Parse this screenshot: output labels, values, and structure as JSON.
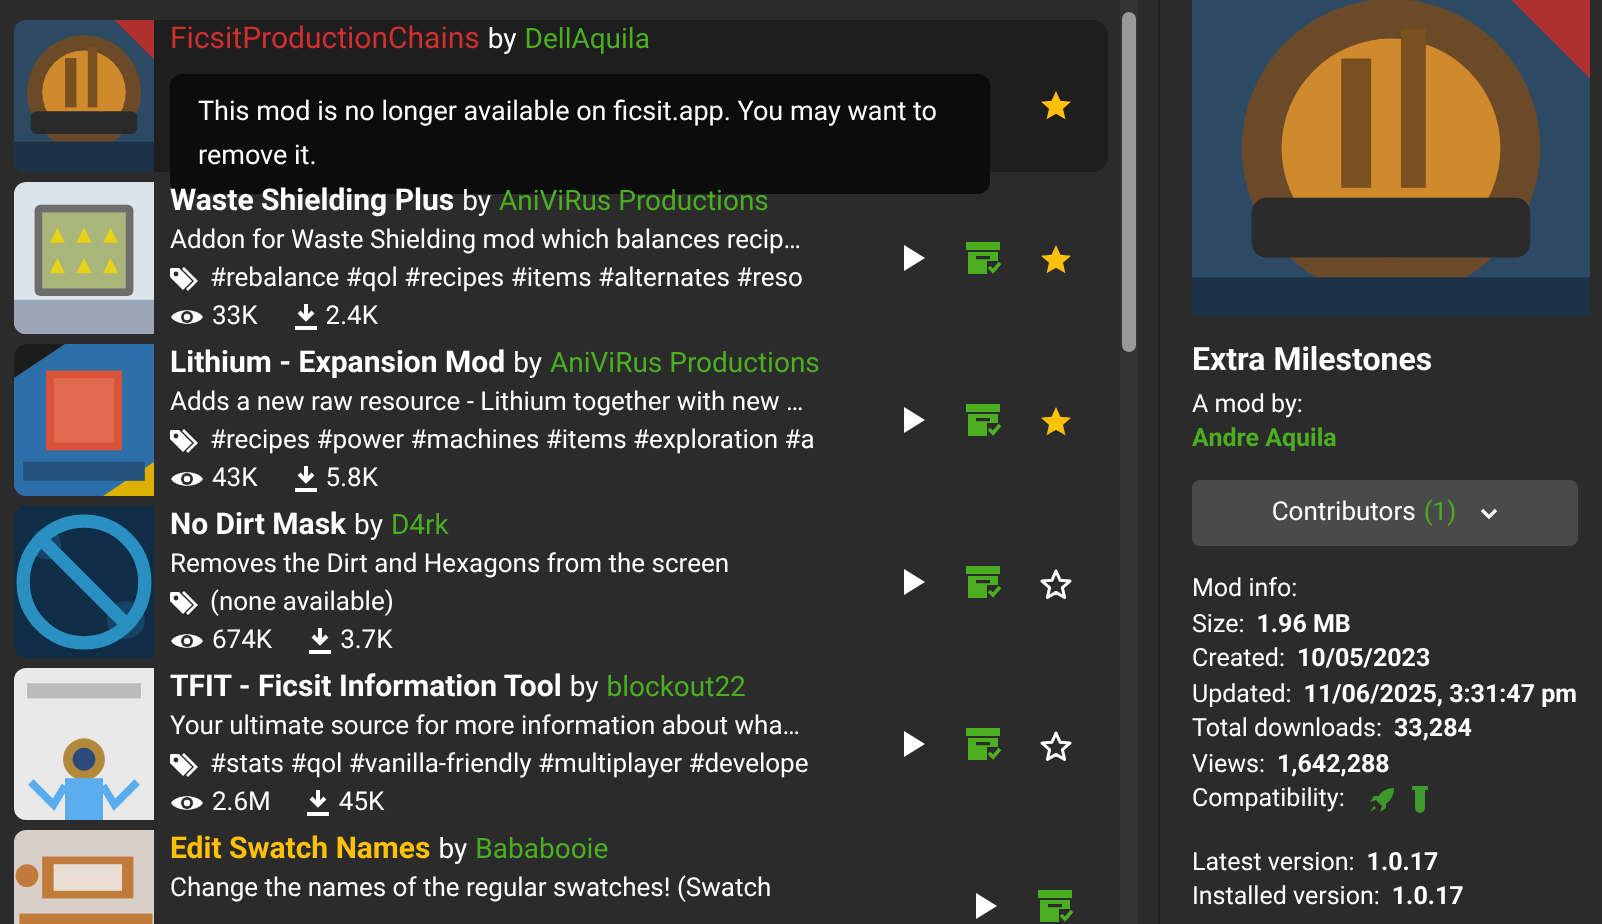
{
  "mods": [
    {
      "kind": "unavailable",
      "title": "FicsitProductionChains",
      "color": "#d32f2f",
      "by": "by",
      "author": "DellAquila",
      "notice": "This mod is no longer available on ficsit.app. You may want to remove it.",
      "favorite": true
    },
    {
      "kind": "installed",
      "title": "Waste Shielding Plus",
      "color": "#ffffff",
      "by": "by",
      "author": "AniViRus Productions",
      "description": "Addon for Waste Shielding mod which balances recip…",
      "tags": "#rebalance #qol #recipes #items #alternates #reso",
      "views": "33K",
      "downloads": "2.4K",
      "favorite": true
    },
    {
      "kind": "installed",
      "title": "Lithium - Expansion Mod",
      "color": "#ffffff",
      "by": "by",
      "author": "AniViRus Productions",
      "description": "Adds a new raw resource - Lithium together with new …",
      "tags": "#recipes #power #machines #items #exploration #a",
      "views": "43K",
      "downloads": "5.8K",
      "favorite": true
    },
    {
      "kind": "installed",
      "title": "No Dirt Mask",
      "color": "#ffffff",
      "by": "by",
      "author": "D4rk",
      "description": "Removes the Dirt and Hexagons from the screen",
      "tags": "(none available)",
      "views": "674K",
      "downloads": "3.7K",
      "favorite": false
    },
    {
      "kind": "installed",
      "title": "TFIT - Ficsit Information Tool",
      "color": "#ffffff",
      "by": "by",
      "author": "blockout22",
      "description": "Your ultimate source for more information about wha…",
      "tags": "#stats #qol #vanilla-friendly #multiplayer #develope",
      "views": "2.6M",
      "downloads": "45K",
      "favorite": false
    },
    {
      "kind": "partial",
      "title": "Edit Swatch Names",
      "color": "#ffc107",
      "by": "by",
      "author": "Bababooie",
      "description": "Change the names of the regular swatches! (Swatch"
    }
  ],
  "details": {
    "title": "Extra Milestones",
    "byline": "A mod by:",
    "author": "Andre Aquila",
    "contributors": {
      "label": "Contributors",
      "count": "(1)",
      "expanded": false
    },
    "info_heading": "Mod info:",
    "info": [
      {
        "label": "Size:",
        "value": "1.96 MB"
      },
      {
        "label": "Created:",
        "value": "10/05/2023"
      },
      {
        "label": "Updated:",
        "value": "11/06/2025, 3:31:47 pm"
      },
      {
        "label": "Total downloads:",
        "value": "33,284"
      },
      {
        "label": "Views:",
        "value": "1,642,288"
      }
    ],
    "compatibility_label": "Compatibility:",
    "versions": [
      {
        "label": "Latest version:",
        "value": "1.0.17"
      },
      {
        "label": "Installed version:",
        "value": "1.0.17"
      }
    ]
  }
}
